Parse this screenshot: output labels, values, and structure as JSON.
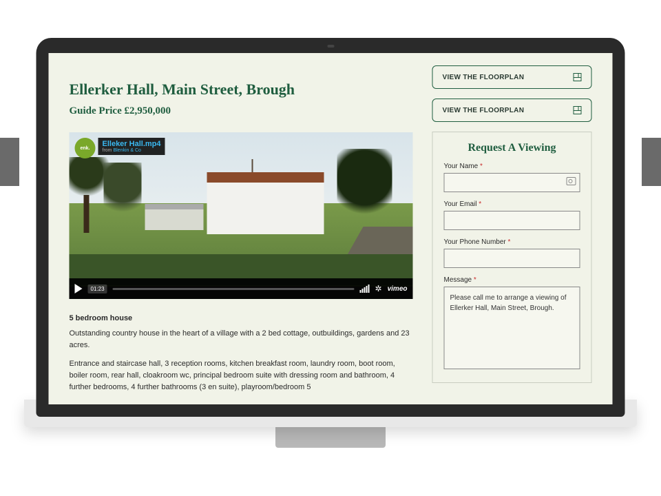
{
  "property": {
    "title": "Ellerker Hall, Main Street, Brough",
    "price": "Guide Price £2,950,000",
    "subheading": "5 bedroom house",
    "description1": "Outstanding country house in the heart of a village with a 2 bed cottage, outbuildings, gardens and 23 acres.",
    "description2": "Entrance and staircase hall, 3 reception rooms, kitchen breakfast room, laundry room, boot room, boiler room, rear hall, cloakroom wc, principal bedroom suite with dressing room and bathroom, 4 further bedrooms, 4 further bathrooms (3 en suite), playroom/bedroom 5"
  },
  "buttons": {
    "floorplan1": "VIEW THE FLOORPLAN",
    "floorplan2": "VIEW THE FLOORPLAN"
  },
  "video": {
    "filename": "Elleker Hall.mp4",
    "from_prefix": "from ",
    "from_author": "Blenkin & Co",
    "logo_text": "enk.",
    "duration": "01:23",
    "provider": "vimeo"
  },
  "form": {
    "title": "Request A Viewing",
    "name_label": "Your Name",
    "email_label": "Your Email",
    "phone_label": "Your Phone Number",
    "message_label": "Message",
    "required": "*",
    "message_value": "Please call me to arrange a viewing of Ellerker Hall, Main Street, Brough."
  }
}
